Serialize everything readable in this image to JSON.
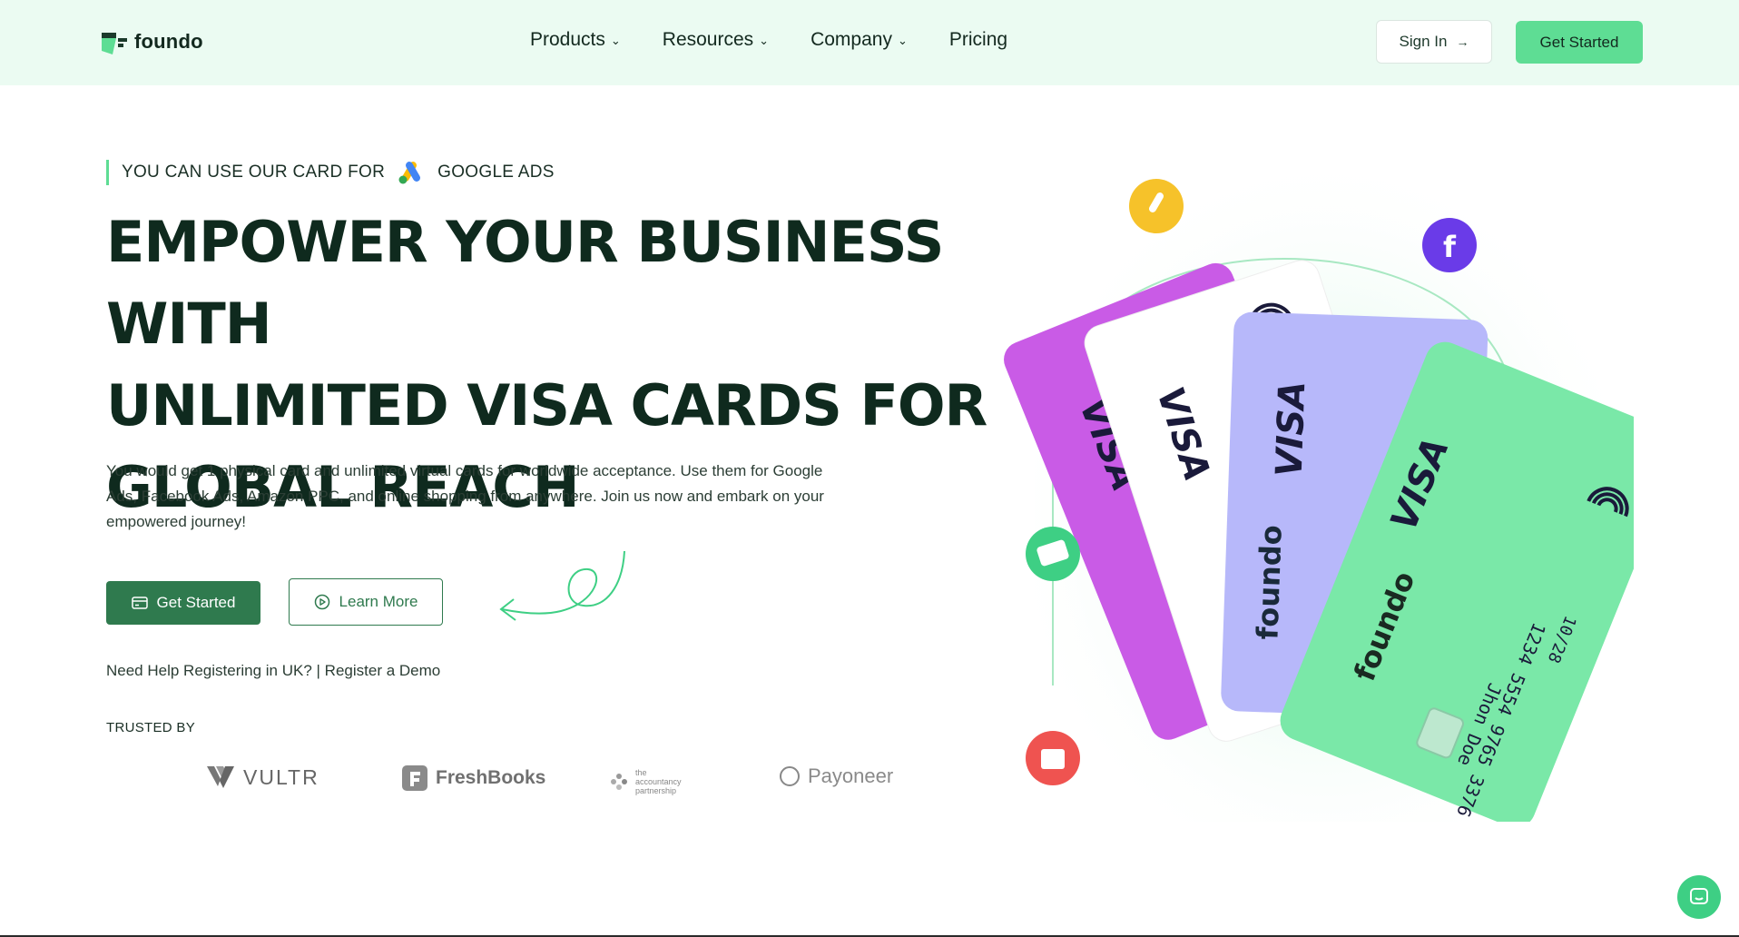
{
  "header": {
    "logo_text": "foundo",
    "nav": [
      "Products",
      "Resources",
      "Company",
      "Pricing"
    ],
    "signin_label": "Sign In",
    "get_started_label": "Get Started"
  },
  "hero": {
    "eyebrow": "YOU CAN USE OUR CARD FOR",
    "eyebrow_partner": "GOOGLE ADS",
    "headline": [
      "EMPOWER YOUR BUSINESS WITH",
      "UNLIMITED VISA CARDS FOR",
      "GLOBAL REACH"
    ],
    "description": "You would get 1 physical card and unlimited virtual cards for worldwide acceptance. Use them for Google Ads, Facebook Ads, Amazon PPC, and online shopping from anywhere. Join us now and embark on your empowered journey!",
    "primary_button": "Get Started",
    "secondary_button": "Learn More",
    "help_text": "Need Help Registering in UK?",
    "help_separator": " | ",
    "help_link": "Register a Demo",
    "trusted_label": "TRUSTED BY",
    "trusted_brands": [
      "VULTR",
      "FreshBooks",
      "the accountancy partnership",
      "Payoneer"
    ]
  },
  "cards": {
    "network": "VISA",
    "brand": "foundo",
    "card_number": "1234 5554 9765 3376",
    "holder": "Jhon Doe",
    "expiry": "10/28"
  },
  "colors": {
    "brand_green": "#5edd94",
    "dark_green": "#2f7a4e",
    "header_bg": "#ebfbf2",
    "card_purple": "#c95be6",
    "card_lavender": "#b7b8fa",
    "card_mint": "#7ae8a8"
  }
}
